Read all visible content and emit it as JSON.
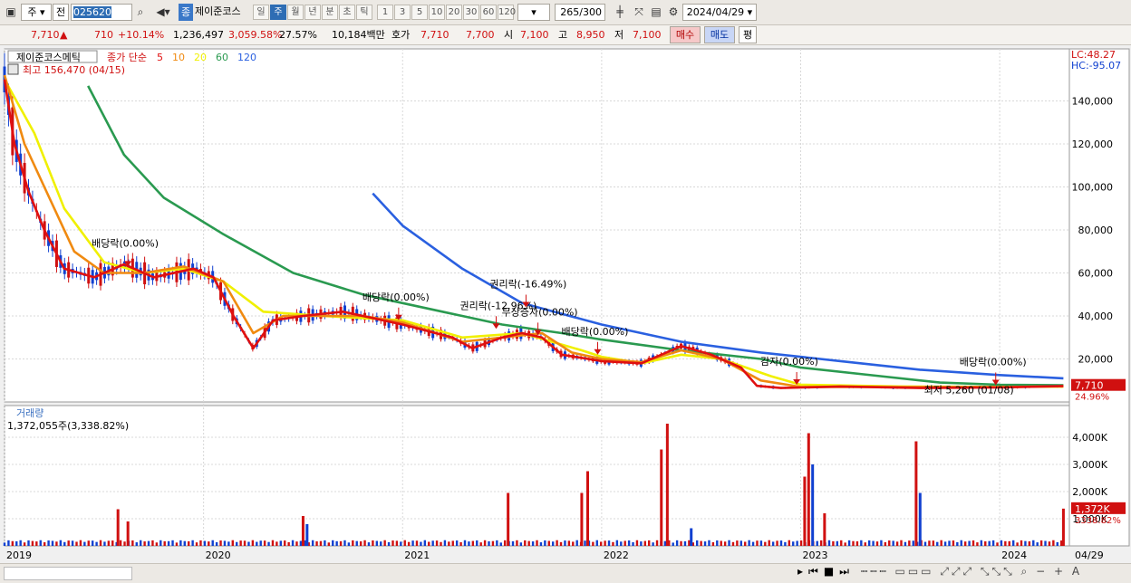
{
  "toolbar": {
    "market": "주",
    "scope": "전",
    "code": "025620",
    "kind_badge": "종",
    "name": "제이준코스",
    "periods": [
      "일",
      "주",
      "월",
      "년",
      "분",
      "초",
      "틱"
    ],
    "active_period": "주",
    "intervals": [
      "1",
      "3",
      "5",
      "10",
      "20",
      "30",
      "60",
      "120"
    ],
    "count": "265",
    "count_total": "/300",
    "date": "2024/04/29"
  },
  "quote": {
    "price": "7,710",
    "arrow": "▲",
    "change": "710",
    "change_pct": "+10.14%",
    "volume": "1,236,497",
    "vol_ratio": "3,059.58%",
    "turnover_pct": "27.57%",
    "amount": "10,184백만",
    "bid_label": "호가",
    "ask": "7,710",
    "bid": "7,700",
    "open_label": "시",
    "open": "7,100",
    "high_label": "고",
    "high": "8,950",
    "low_label": "저",
    "low": "7,100",
    "buy_label": "매수",
    "sell_label": "매도",
    "avg_label": "평"
  },
  "chart_data": {
    "type": "candlestick",
    "price_panel": {
      "stock_name": "제이준코스메틱",
      "ma_label": "종가 단순",
      "ma_periods": [
        {
          "period": "5",
          "color": "#e01010"
        },
        {
          "period": "10",
          "color": "#f08a10"
        },
        {
          "period": "20",
          "color": "#f0f000"
        },
        {
          "period": "60",
          "color": "#2a9a50"
        },
        {
          "period": "120",
          "color": "#2a60e0"
        }
      ],
      "high_note": "최고 156,470 (04/15)",
      "low_note": "최저 5,260 (01/08)",
      "lc": "LC:48.27",
      "hc": "HC:-95.07",
      "last_price": "7,710",
      "last_pct": "24.96%",
      "y_ticks": [
        20000,
        40000,
        60000,
        80000,
        100000,
        120000,
        140000
      ],
      "y_tick_labels": [
        "20,000",
        "40,000",
        "60,000",
        "80,000",
        "100,000",
        "120,000",
        "140,000"
      ],
      "ylim": [
        0,
        160000
      ],
      "x_labels": [
        "2019",
        "2020",
        "2021",
        "2022",
        "2023",
        "2024"
      ],
      "x_end_label": "04/29",
      "ma5": [
        [
          2019.0,
          150000
        ],
        [
          2019.05,
          120000
        ],
        [
          2019.12,
          98000
        ],
        [
          2019.2,
          80000
        ],
        [
          2019.3,
          62000
        ],
        [
          2019.45,
          58000
        ],
        [
          2019.6,
          64000
        ],
        [
          2019.75,
          58000
        ],
        [
          2019.95,
          62000
        ],
        [
          2020.05,
          58000
        ],
        [
          2020.15,
          40000
        ],
        [
          2020.25,
          25000
        ],
        [
          2020.35,
          38000
        ],
        [
          2020.5,
          40000
        ],
        [
          2020.7,
          42000
        ],
        [
          2021.0,
          36000
        ],
        [
          2021.25,
          30000
        ],
        [
          2021.35,
          25000
        ],
        [
          2021.5,
          30000
        ],
        [
          2021.6,
          32000
        ],
        [
          2021.7,
          30000
        ],
        [
          2021.8,
          22000
        ],
        [
          2022.0,
          19000
        ],
        [
          2022.2,
          18000
        ],
        [
          2022.4,
          26000
        ],
        [
          2022.55,
          22000
        ],
        [
          2022.7,
          16000
        ],
        [
          2022.78,
          7500
        ],
        [
          2022.9,
          6500
        ],
        [
          2023.2,
          7200
        ],
        [
          2023.6,
          6500
        ],
        [
          2024.0,
          6800
        ],
        [
          2024.32,
          7400
        ]
      ],
      "ma10": [
        [
          2019.0,
          152000
        ],
        [
          2019.1,
          120000
        ],
        [
          2019.2,
          100000
        ],
        [
          2019.35,
          70000
        ],
        [
          2019.5,
          60000
        ],
        [
          2019.7,
          60000
        ],
        [
          2019.9,
          63000
        ],
        [
          2020.1,
          56000
        ],
        [
          2020.25,
          32000
        ],
        [
          2020.4,
          40000
        ],
        [
          2020.8,
          40000
        ],
        [
          2021.0,
          37000
        ],
        [
          2021.3,
          28000
        ],
        [
          2021.5,
          30000
        ],
        [
          2021.7,
          32000
        ],
        [
          2021.85,
          23000
        ],
        [
          2022.0,
          20000
        ],
        [
          2022.2,
          18500
        ],
        [
          2022.4,
          24000
        ],
        [
          2022.6,
          20000
        ],
        [
          2022.8,
          10000
        ],
        [
          2023.0,
          7000
        ],
        [
          2023.5,
          7000
        ],
        [
          2024.0,
          6900
        ],
        [
          2024.32,
          7300
        ]
      ],
      "ma20": [
        [
          2019.0,
          150000
        ],
        [
          2019.15,
          125000
        ],
        [
          2019.3,
          90000
        ],
        [
          2019.5,
          65000
        ],
        [
          2019.7,
          60000
        ],
        [
          2019.9,
          62000
        ],
        [
          2020.1,
          56000
        ],
        [
          2020.3,
          42000
        ],
        [
          2020.6,
          40000
        ],
        [
          2021.0,
          38000
        ],
        [
          2021.3,
          30000
        ],
        [
          2021.6,
          32000
        ],
        [
          2021.9,
          24000
        ],
        [
          2022.0,
          21000
        ],
        [
          2022.2,
          18000
        ],
        [
          2022.4,
          22000
        ],
        [
          2022.6,
          20000
        ],
        [
          2022.85,
          12000
        ],
        [
          2023.0,
          8000
        ],
        [
          2023.5,
          7200
        ],
        [
          2024.0,
          7000
        ],
        [
          2024.32,
          7100
        ]
      ],
      "ma60": [
        [
          2019.42,
          147000
        ],
        [
          2019.6,
          115000
        ],
        [
          2019.8,
          95000
        ],
        [
          2020.1,
          78000
        ],
        [
          2020.45,
          60000
        ],
        [
          2020.8,
          50000
        ],
        [
          2021.2,
          42000
        ],
        [
          2021.5,
          36000
        ],
        [
          2021.8,
          32000
        ],
        [
          2022.0,
          29000
        ],
        [
          2022.4,
          24000
        ],
        [
          2022.8,
          20000
        ],
        [
          2023.0,
          16000
        ],
        [
          2023.4,
          12000
        ],
        [
          2023.7,
          9000
        ],
        [
          2024.0,
          8000
        ],
        [
          2024.32,
          7800
        ]
      ],
      "ma120": [
        [
          2020.85,
          97000
        ],
        [
          2021.0,
          82000
        ],
        [
          2021.3,
          62000
        ],
        [
          2021.6,
          46000
        ],
        [
          2022.0,
          36000
        ],
        [
          2022.4,
          28000
        ],
        [
          2022.8,
          23000
        ],
        [
          2023.2,
          19000
        ],
        [
          2023.6,
          15000
        ],
        [
          2024.0,
          12500
        ],
        [
          2024.32,
          11000
        ]
      ],
      "events": [
        {
          "label": "배당락(0.00%)",
          "x": 2019.62,
          "y": 63000
        },
        {
          "label": "배당락(0.00%)",
          "x": 2020.98,
          "y": 38000
        },
        {
          "label": "권리락(-12.96%)",
          "x": 2021.47,
          "y": 34000
        },
        {
          "label": "권리락(-16.49%)",
          "x": 2021.62,
          "y": 44000
        },
        {
          "label": "무상증자(0.00%)",
          "x": 2021.68,
          "y": 31000
        },
        {
          "label": "배당락(0.00%)",
          "x": 2021.98,
          "y": 22000
        },
        {
          "label": "감자(0.00%)",
          "x": 2022.98,
          "y": 8000
        },
        {
          "label": "배당락(0.00%)",
          "x": 2023.98,
          "y": 7800
        }
      ]
    },
    "volume_panel": {
      "title": "거래량",
      "last_volume": "1,372,055주(3,338.82%)",
      "y_ticks": [
        1000,
        2000,
        3000,
        4000
      ],
      "y_tick_labels": [
        "1,000K",
        "2,000K",
        "3,000K",
        "4,000K"
      ],
      "ylim": [
        0,
        4700
      ],
      "last_label": "1,372K",
      "last_pct": "3338.82%",
      "spikes": [
        {
          "x": 2019.57,
          "v": 1350,
          "color": "red"
        },
        {
          "x": 2019.62,
          "v": 900,
          "color": "red"
        },
        {
          "x": 2020.5,
          "v": 1100,
          "color": "red"
        },
        {
          "x": 2020.52,
          "v": 800,
          "color": "blue"
        },
        {
          "x": 2021.53,
          "v": 1950,
          "color": "red"
        },
        {
          "x": 2021.9,
          "v": 1950,
          "color": "red"
        },
        {
          "x": 2021.93,
          "v": 2750,
          "color": "red"
        },
        {
          "x": 2022.3,
          "v": 3550,
          "color": "red"
        },
        {
          "x": 2022.33,
          "v": 4500,
          "color": "red"
        },
        {
          "x": 2022.45,
          "v": 650,
          "color": "blue"
        },
        {
          "x": 2023.02,
          "v": 2550,
          "color": "red"
        },
        {
          "x": 2023.04,
          "v": 4150,
          "color": "red"
        },
        {
          "x": 2023.06,
          "v": 3000,
          "color": "blue"
        },
        {
          "x": 2023.12,
          "v": 1200,
          "color": "red"
        },
        {
          "x": 2023.58,
          "v": 3850,
          "color": "red"
        },
        {
          "x": 2023.6,
          "v": 1950,
          "color": "blue"
        },
        {
          "x": 2024.32,
          "v": 1372,
          "color": "red"
        }
      ]
    }
  }
}
